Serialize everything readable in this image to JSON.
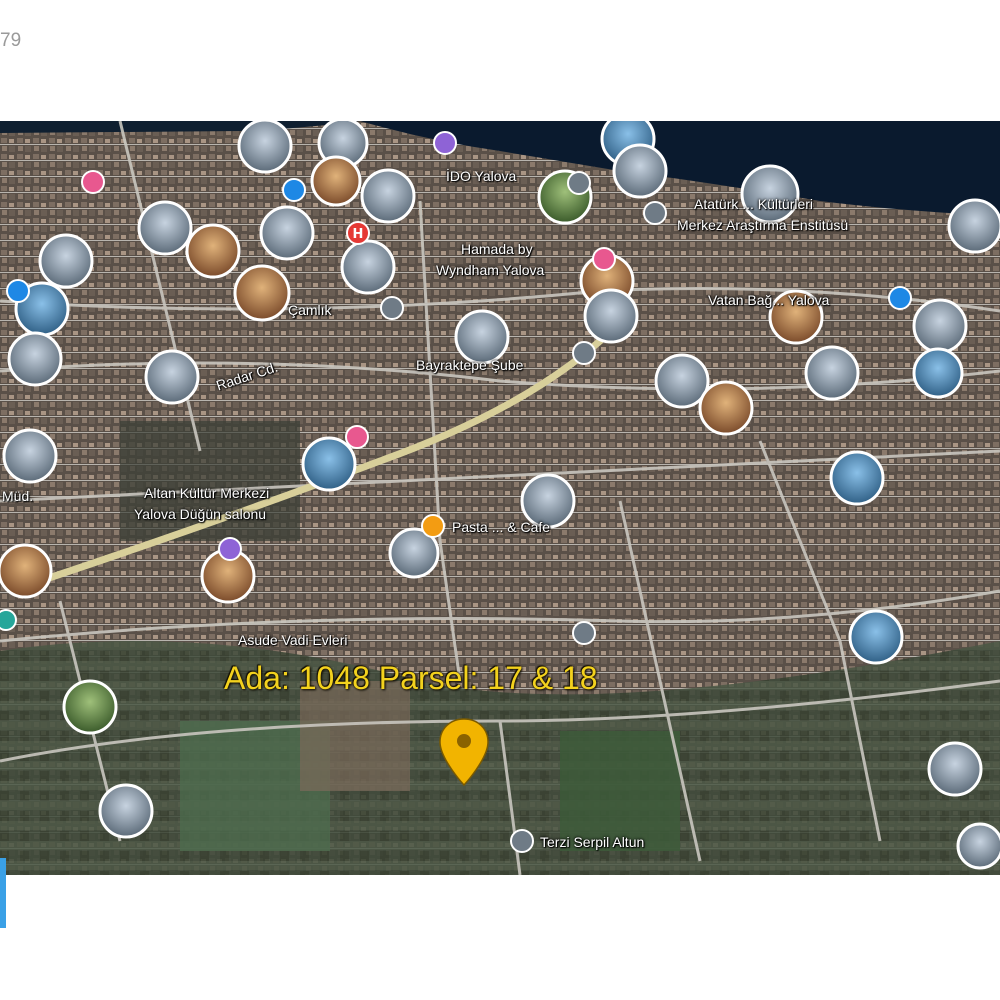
{
  "page": {
    "corner_text": "79"
  },
  "map": {
    "parcel_label": "Ada: 1048  Parsel: 17 & 18",
    "labels": [
      {
        "name": "ido-yalova",
        "text": "İDO Yalova"
      },
      {
        "name": "ataturk-kulturleri",
        "text": "Atatürk ... Kültürleri"
      },
      {
        "name": "merkez-arastirma",
        "text": "Merkez Araştırma Enstitüsü"
      },
      {
        "name": "hamada-by",
        "text": "Hamada by"
      },
      {
        "name": "wyndham-yalova",
        "text": "Wyndham Yalova"
      },
      {
        "name": "vatan-bag",
        "text": "Vatan Bağ... Yalova"
      },
      {
        "name": "camlik",
        "text": "Çamlık"
      },
      {
        "name": "bayrakdepe-sube",
        "text": "Bayraktepe Şube"
      },
      {
        "name": "altan-kultur-merkezi",
        "text": "Altan Kültür Merkezi"
      },
      {
        "name": "yalova-dugun",
        "text": "Yalova Düğün salonu"
      },
      {
        "name": "pasta-cafe",
        "text": "Pasta ... & Cafe"
      },
      {
        "name": "asude-vadi-evleri",
        "text": "Asude Vadi Evleri"
      },
      {
        "name": "terzi-serpil-altun",
        "text": "Terzi Serpil Altun"
      },
      {
        "name": "radar-cd",
        "text": "Radar Cd."
      },
      {
        "name": "mud",
        "text": "Müd."
      }
    ],
    "colors": {
      "sea": "#0a1a2e",
      "pin": "#f2b400",
      "parcel_text": "#f3d21e",
      "road_main": "#d8cf9a"
    },
    "icons": {
      "pin": "map-pin-icon",
      "hotel": "hotel-icon",
      "food": "restaurant-icon",
      "pink": "shopping-icon",
      "blue": "info-icon",
      "purple": "place-icon"
    }
  }
}
